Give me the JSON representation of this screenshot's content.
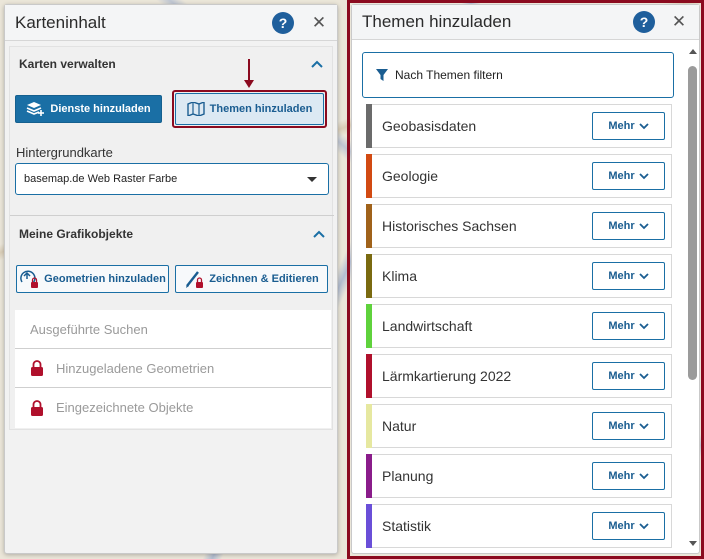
{
  "left_panel": {
    "title": "Karteninhalt",
    "help_label": "?",
    "close_label": "✕",
    "section_maps": {
      "title": "Karten verwalten",
      "add_services_label": "Dienste hinzuladen",
      "add_themes_label": "Themen hinzuladen",
      "basemap_label": "Hintergrundkarte",
      "basemap_value": "basemap.de Web Raster Farbe"
    },
    "section_graphics": {
      "title": "Meine Grafikobjekte",
      "add_geometries_label": "Geometrien hinzuladen",
      "draw_edit_label": "Zeichnen & Editieren",
      "items": [
        {
          "label": "Ausgeführte Suchen",
          "locked": false
        },
        {
          "label": "Hinzugeladene Geometrien",
          "locked": true
        },
        {
          "label": "Eingezeichnete Objekte",
          "locked": true
        }
      ]
    }
  },
  "right_panel": {
    "title": "Themen hinzuladen",
    "help_label": "?",
    "close_label": "✕",
    "filter_label": "Nach Themen filtern",
    "more_label": "Mehr",
    "topics": [
      {
        "label": "Geobasisdaten",
        "color": "#6b6b6b"
      },
      {
        "label": "Geologie",
        "color": "#d24a12"
      },
      {
        "label": "Historisches Sachsen",
        "color": "#a0621a"
      },
      {
        "label": "Klima",
        "color": "#7a6a10"
      },
      {
        "label": "Landwirtschaft",
        "color": "#5fd23c"
      },
      {
        "label": "Lärmkartierung 2022",
        "color": "#b0102c"
      },
      {
        "label": "Natur",
        "color": "#e6e8a0"
      },
      {
        "label": "Planung",
        "color": "#8a1c8a"
      },
      {
        "label": "Statistik",
        "color": "#6a4fd8"
      }
    ]
  },
  "colors": {
    "accent": "#1a6fa5",
    "highlight": "#8b0a1f",
    "lock": "#b0102c"
  }
}
